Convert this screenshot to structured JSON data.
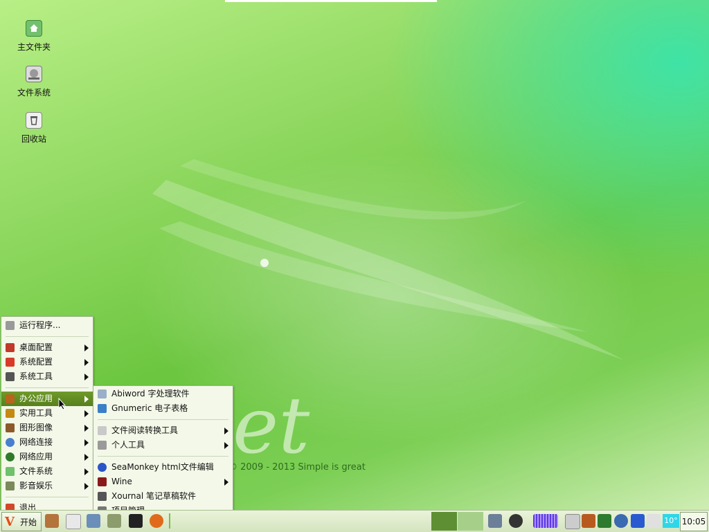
{
  "desktop": {
    "icons": [
      {
        "label": "主文件夹",
        "icon": "home-folder-icon"
      },
      {
        "label": "文件系统",
        "icon": "drive-icon"
      },
      {
        "label": "回收站",
        "icon": "trash-icon"
      }
    ],
    "wallpaper": {
      "logo": "et",
      "copyright": "© 2009 - 2013 Simple is great"
    }
  },
  "start_menu": {
    "items": [
      {
        "label": "运行程序...",
        "icon": "run-gears-icon",
        "submenu": false
      },
      {
        "label": "桌面配置",
        "icon": "desktop-config-icon",
        "submenu": true
      },
      {
        "label": "系统配置",
        "icon": "system-config-icon",
        "submenu": true
      },
      {
        "label": "系统工具",
        "icon": "system-tools-icon",
        "submenu": true
      },
      {
        "label": "办公应用",
        "icon": "office-icon",
        "submenu": true,
        "selected": true
      },
      {
        "label": "实用工具",
        "icon": "utilities-icon",
        "submenu": true
      },
      {
        "label": "图形图像",
        "icon": "graphics-icon",
        "submenu": true
      },
      {
        "label": "网络连接",
        "icon": "network-connect-icon",
        "submenu": true
      },
      {
        "label": "网络应用",
        "icon": "network-apps-icon",
        "submenu": true
      },
      {
        "label": "文件系统",
        "icon": "filesystem-icon",
        "submenu": true
      },
      {
        "label": "影音娱乐",
        "icon": "multimedia-icon",
        "submenu": true
      },
      {
        "label": "退出",
        "icon": "exit-icon",
        "submenu": false
      }
    ]
  },
  "office_submenu": {
    "items": [
      {
        "label": "Abiword 字处理软件",
        "icon": "abiword-icon",
        "submenu": false
      },
      {
        "label": "Gnumeric 电子表格",
        "icon": "gnumeric-icon",
        "submenu": false
      },
      {
        "label": "文件阅读转换工具",
        "icon": "document-reader-icon",
        "submenu": true
      },
      {
        "label": "个人工具",
        "icon": "personal-tools-icon",
        "submenu": true
      },
      {
        "label": "SeaMonkey html文件编辑",
        "icon": "seamonkey-icon",
        "submenu": false
      },
      {
        "label": "Wine",
        "icon": "wine-glass-icon",
        "submenu": true
      },
      {
        "label": "Xournal 笔记草稿软件",
        "icon": "xournal-icon",
        "submenu": false
      },
      {
        "label": "项目管理",
        "icon": "project-management-icon",
        "submenu": false
      }
    ]
  },
  "taskbar": {
    "start_label": "开始",
    "quicklaunch": [
      "hammer-tool-icon",
      "puppy-icon",
      "settings-tools-icon",
      "image-viewer-icon",
      "terminal-icon",
      "firefox-icon"
    ],
    "workspaces": 2,
    "tray": [
      "screenshot-icon",
      "camera-icon",
      "keyboard-icon",
      "network-status-icon",
      "stack-icon",
      "update-icon",
      "power-icon",
      "volume-icon"
    ],
    "temperature": "10°",
    "clock": "10:05"
  },
  "colors": {
    "accent": "#57801d",
    "menu_bg": "#f3f8e8",
    "tray_temp": "#2fd6e8"
  }
}
